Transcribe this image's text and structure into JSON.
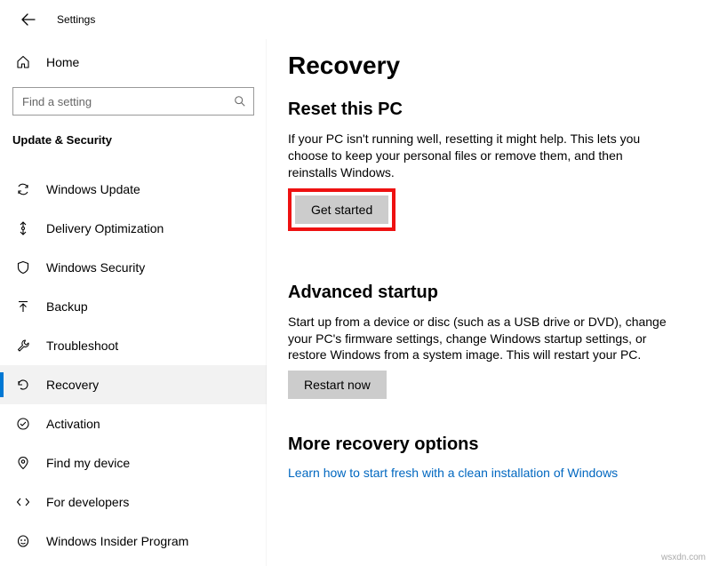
{
  "app": {
    "title": "Settings"
  },
  "sidebar": {
    "home_label": "Home",
    "search_placeholder": "Find a setting",
    "category": "Update & Security",
    "items": [
      {
        "id": "windows-update",
        "label": "Windows Update"
      },
      {
        "id": "delivery-optimization",
        "label": "Delivery Optimization"
      },
      {
        "id": "windows-security",
        "label": "Windows Security"
      },
      {
        "id": "backup",
        "label": "Backup"
      },
      {
        "id": "troubleshoot",
        "label": "Troubleshoot"
      },
      {
        "id": "recovery",
        "label": "Recovery",
        "selected": true
      },
      {
        "id": "activation",
        "label": "Activation"
      },
      {
        "id": "find-my-device",
        "label": "Find my device"
      },
      {
        "id": "for-developers",
        "label": "For developers"
      },
      {
        "id": "windows-insider",
        "label": "Windows Insider Program"
      }
    ]
  },
  "page": {
    "title": "Recovery",
    "reset": {
      "heading": "Reset this PC",
      "desc": "If your PC isn't running well, resetting it might help. This lets you choose to keep your personal files or remove them, and then reinstalls Windows.",
      "button": "Get started"
    },
    "advanced": {
      "heading": "Advanced startup",
      "desc": "Start up from a device or disc (such as a USB drive or DVD), change your PC's firmware settings, change Windows startup settings, or restore Windows from a system image. This will restart your PC.",
      "button": "Restart now"
    },
    "more": {
      "heading": "More recovery options",
      "link": "Learn how to start fresh with a clean installation of Windows"
    }
  },
  "watermark": "wsxdn.com"
}
